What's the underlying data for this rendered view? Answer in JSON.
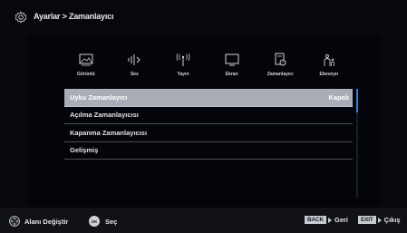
{
  "header": {
    "breadcrumb": "Ayarlar > Zamanlayıcı",
    "icon": "gear-icon"
  },
  "tabs": [
    {
      "label": "Görüntü",
      "icon": "picture-icon"
    },
    {
      "label": "Ses",
      "icon": "sound-icon"
    },
    {
      "label": "Yayın",
      "icon": "antenna-icon"
    },
    {
      "label": "Ekran",
      "icon": "monitor-icon"
    },
    {
      "label": "Zamanlayıcı",
      "icon": "timer-icon"
    },
    {
      "label": "Ebeveyn",
      "icon": "parental-icon"
    }
  ],
  "menu": {
    "items": [
      {
        "label": "Uyku Zamanlayıcı",
        "value": "Kapalı",
        "selected": true
      },
      {
        "label": "Açılma Zamanlayıcısı",
        "value": ""
      },
      {
        "label": "Kapanma Zamanlayıcısı",
        "value": ""
      },
      {
        "label": "Gelişmiş",
        "value": ""
      }
    ]
  },
  "footer": {
    "nav_label": "Alanı Değiştir",
    "ok_key": "OK",
    "ok_label": "Seç",
    "back_key": "BACK",
    "back_label": "Geri",
    "exit_key": "EXIT",
    "exit_label": "Çıkış"
  },
  "colors": {
    "accent": "#2f7fd8",
    "selected_row": "#a9adb5",
    "background": "#07080d"
  }
}
